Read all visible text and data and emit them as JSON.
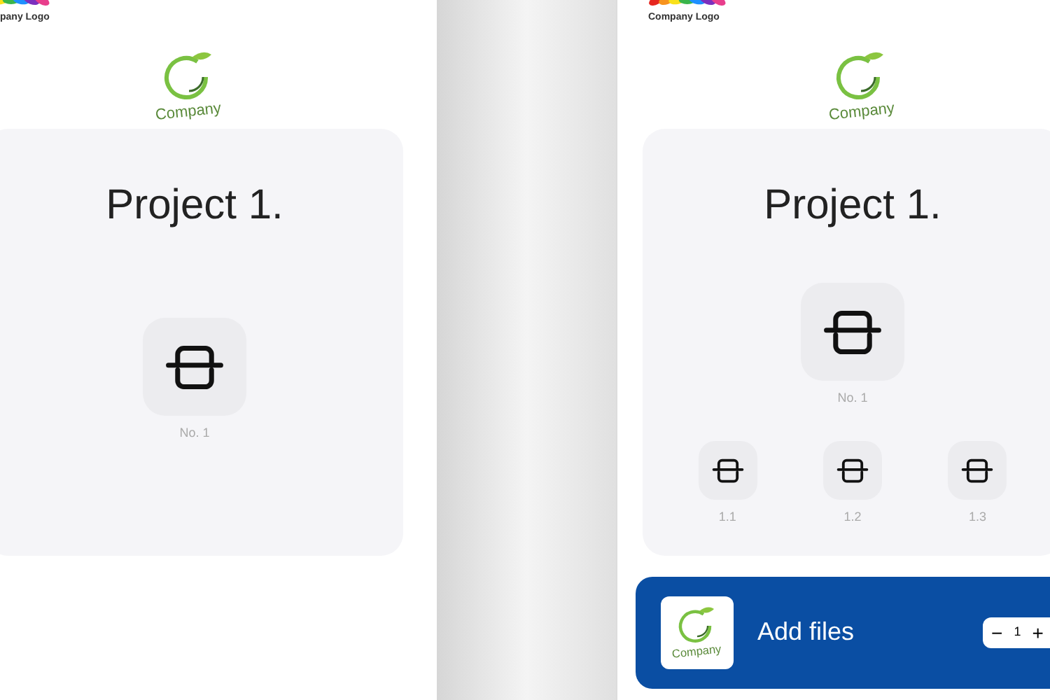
{
  "screens": [
    {
      "header_logo": "pany Logo",
      "brand_logo": "Company",
      "project": {
        "title": "Project 1.",
        "main": {
          "label": "No. 1"
        }
      }
    },
    {
      "header_logo": "Company Logo",
      "brand_logo": "Company",
      "project": {
        "title": "Project 1.",
        "main": {
          "label": "No. 1"
        },
        "children": [
          {
            "label": "1.1"
          },
          {
            "label": "1.2"
          },
          {
            "label": "1.3"
          }
        ]
      },
      "add_bar": {
        "logo": "Company",
        "label": "Add files",
        "stepper": {
          "minus": "−",
          "value": "1",
          "plus": "+"
        }
      }
    }
  ]
}
